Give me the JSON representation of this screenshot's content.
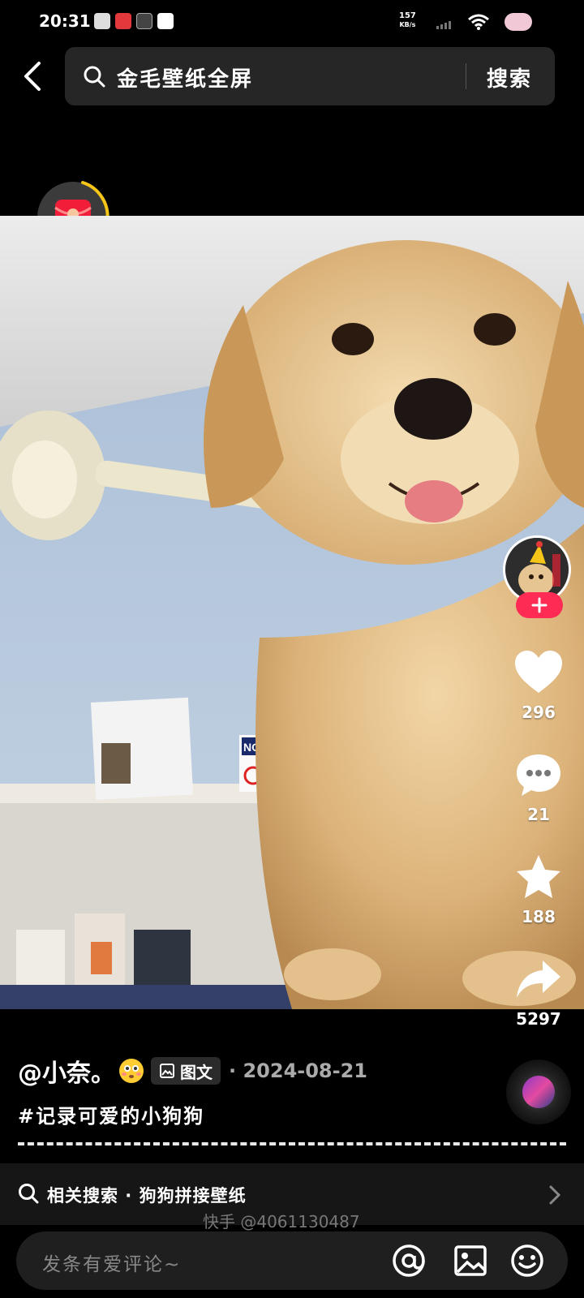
{
  "status_bar": {
    "time": "20:31",
    "speed_value": "157",
    "speed_unit": "KB/s"
  },
  "search": {
    "query": "金毛壁纸全屏",
    "button_label": "搜索"
  },
  "actions": {
    "likes": "296",
    "comments": "21",
    "favorites": "188",
    "shares": "5297"
  },
  "post": {
    "author": "@小奈。",
    "type_label": "图文",
    "date": "· 2024-08-21",
    "hashtag": "#记录可爱的小狗狗"
  },
  "related": {
    "label": "相关搜索 · 狗狗拼接壁纸"
  },
  "watermark": "快手 @4061130487",
  "comment": {
    "placeholder": "发条有爱评论~"
  },
  "colors": {
    "accent": "#fe2c55",
    "background": "#000000",
    "search_bg": "#262626"
  },
  "icons": [
    "back-arrow-icon",
    "search-icon",
    "red-packet-icon",
    "heart-icon",
    "comment-icon",
    "star-icon",
    "share-icon",
    "at-icon",
    "image-icon",
    "emoji-icon",
    "chevron-right-icon",
    "music-disc-icon"
  ]
}
